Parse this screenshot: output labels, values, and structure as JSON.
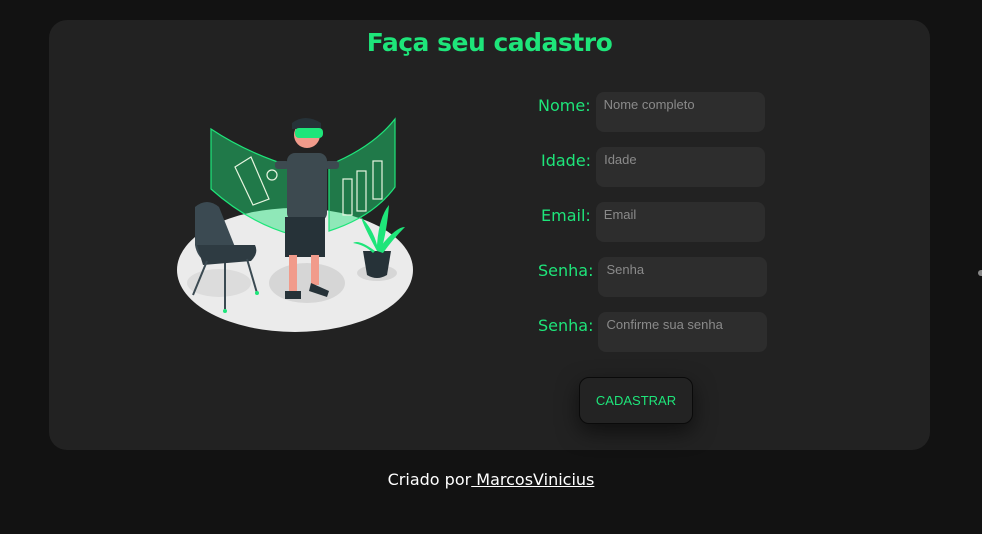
{
  "page": {
    "title": "Faça seu cadastro"
  },
  "form": {
    "fields": [
      {
        "label": "Nome:",
        "placeholder": "Nome completo"
      },
      {
        "label": "Idade:",
        "placeholder": "Idade"
      },
      {
        "label": "Email:",
        "placeholder": "Email"
      },
      {
        "label": "Senha:",
        "placeholder": "Senha"
      },
      {
        "label": "Senha:",
        "placeholder": "Confirme sua senha"
      }
    ],
    "submit_label": "CADASTRAR"
  },
  "footer": {
    "prefix": "Criado por",
    "author_link": " MarcosVinicius"
  },
  "colors": {
    "accent": "#1ee57a",
    "card": "#222222",
    "background": "#121212",
    "input": "#2d2d2d"
  },
  "illustration": {
    "icon": "vr-person-illustration"
  }
}
